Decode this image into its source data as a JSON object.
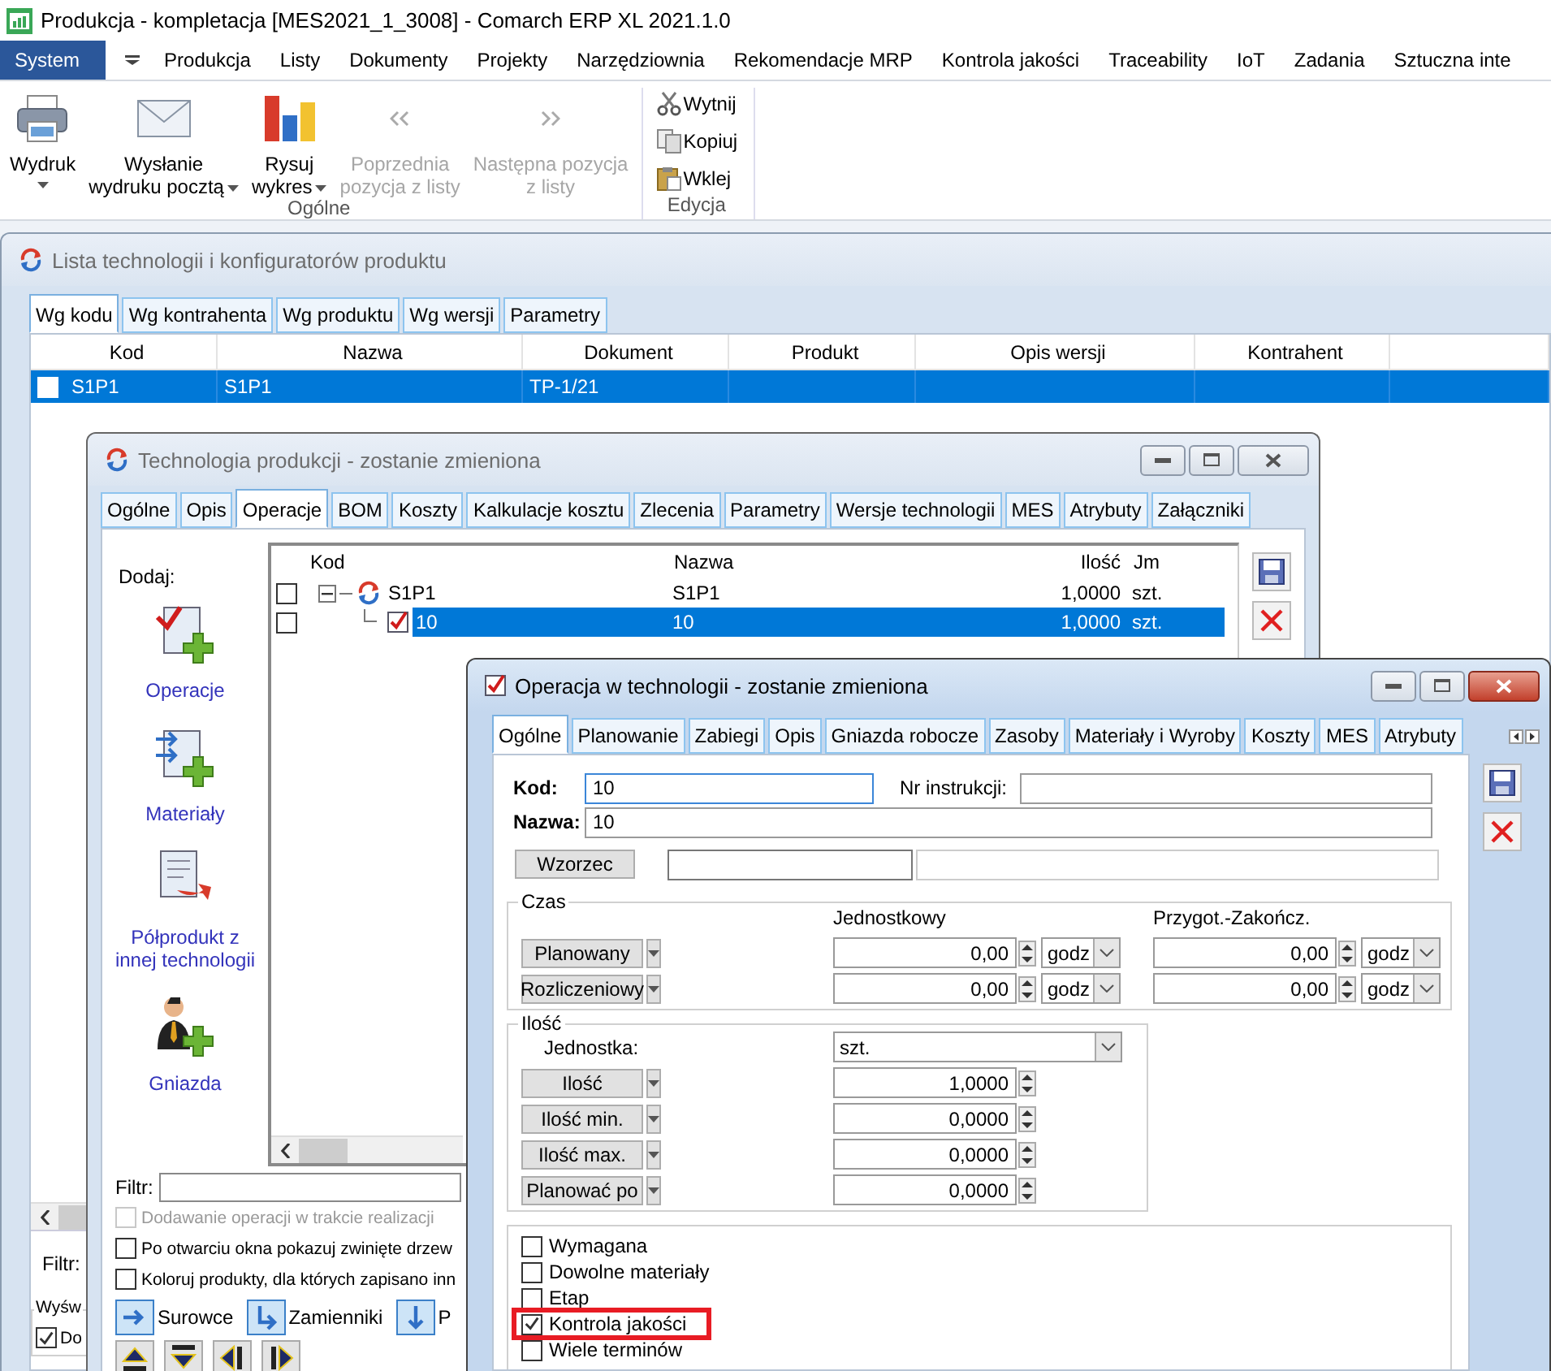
{
  "app": {
    "title": "Produkcja - kompletacja [MES2021_1_3008] - Comarch ERP XL 2021.1.0"
  },
  "ribbon": {
    "tabs": [
      {
        "label": "System",
        "selected": true
      },
      {
        "label": "Produkcja",
        "selected": false
      },
      {
        "label": "Listy",
        "selected": false
      },
      {
        "label": "Dokumenty",
        "selected": false
      },
      {
        "label": "Projekty",
        "selected": false
      },
      {
        "label": "Narzędziownia",
        "selected": false
      },
      {
        "label": "Rekomendacje MRP",
        "selected": false
      },
      {
        "label": "Kontrola jakości",
        "selected": false
      },
      {
        "label": "Traceability",
        "selected": false
      },
      {
        "label": "IoT",
        "selected": false
      },
      {
        "label": "Zadania",
        "selected": false
      },
      {
        "label": "Sztuczna inte",
        "selected": false
      }
    ],
    "groups": [
      {
        "label": "Ogólne",
        "kind": "large",
        "buttons": [
          {
            "label": "Wydruk",
            "kind": "printer",
            "dropdown": true,
            "disabled": false
          },
          {
            "label": "Wysłanie\nwydruku pocztą",
            "kind": "mail",
            "dropdown": true,
            "disabled": false
          },
          {
            "label": "Rysuj\nwykres",
            "kind": "chart",
            "dropdown": true,
            "disabled": false
          },
          {
            "label": "Poprzednia\npozycja z listy",
            "kind": "previous",
            "dropdown": false,
            "disabled": true
          },
          {
            "label": "Następna pozycja\nz listy",
            "kind": "next",
            "dropdown": false,
            "disabled": true
          }
        ]
      },
      {
        "label": "Edycja",
        "kind": "small",
        "buttons": [
          {
            "label": "Wytnij",
            "kind": "cut"
          },
          {
            "label": "Kopiuj",
            "kind": "copy"
          },
          {
            "label": "Wklej",
            "kind": "paste"
          }
        ]
      }
    ]
  },
  "list_window": {
    "title": "Lista technologii i konfiguratorów produktu",
    "tabs": [
      {
        "label": "Wg kodu",
        "selected": true
      },
      {
        "label": "Wg kontrahenta",
        "selected": false
      },
      {
        "label": "Wg produktu",
        "selected": false
      },
      {
        "label": "Wg wersji",
        "selected": false
      },
      {
        "label": "Parametry",
        "selected": false
      }
    ],
    "table": {
      "columns": [
        "Kod",
        "Nazwa",
        "Dokument",
        "Produkt",
        "Opis wersji",
        "Kontrahent"
      ],
      "rows": [
        {
          "checked": false,
          "selected": true,
          "cells": [
            "S1P1",
            "S1P1",
            "TP-1/21"
          ]
        }
      ]
    },
    "filter": {
      "label": "Filtr:"
    },
    "display_group": {
      "label": "Wyśw",
      "option": {
        "label": "Do",
        "checked": true
      }
    }
  },
  "technology_window": {
    "title": "Technologia produkcji - zostanie zmieniona",
    "tabs": [
      {
        "label": "Ogólne",
        "selected": false
      },
      {
        "label": "Opis",
        "selected": false
      },
      {
        "label": "Operacje",
        "selected": true
      },
      {
        "label": "BOM",
        "selected": false
      },
      {
        "label": "Koszty",
        "selected": false
      },
      {
        "label": "Kalkulacje kosztu",
        "selected": false
      },
      {
        "label": "Zlecenia",
        "selected": false
      },
      {
        "label": "Parametry",
        "selected": false
      },
      {
        "label": "Wersje technologii",
        "selected": false
      },
      {
        "label": "MES",
        "selected": false
      },
      {
        "label": "Atrybuty",
        "selected": false
      },
      {
        "label": "Załączniki",
        "selected": false
      }
    ],
    "add_panel": {
      "label": "Dodaj:",
      "items": [
        {
          "label": "Operacje",
          "kind": "operation"
        },
        {
          "label": "Materiały",
          "kind": "material"
        },
        {
          "label": "Półprodukt z\ninnej technologii",
          "kind": "semi"
        },
        {
          "label": "Gniazda",
          "kind": "station"
        }
      ]
    },
    "tree": {
      "columns": [
        "Kod",
        "Nazwa",
        "Ilość",
        "Jm"
      ],
      "rows": [
        {
          "code": "S1P1",
          "name": "S1P1",
          "qty": "1,0000",
          "unit": "szt.",
          "kind": "technology",
          "checked": false,
          "selected": false,
          "expanded": true,
          "children": [
            {
              "code": "10",
              "name": "10",
              "qty": "1,0000",
              "unit": "szt.",
              "kind": "operation",
              "checked": false,
              "selected": true
            }
          ]
        }
      ]
    },
    "filter": {
      "label": "Filtr:"
    },
    "options": [
      {
        "label": "Dodawanie operacji w trakcie realizacji",
        "checked": false,
        "disabled": true
      },
      {
        "label": "Po otwarciu okna pokazuj zwinięte drzew",
        "checked": false,
        "disabled": false
      },
      {
        "label": "Koloruj produkty, dla których zapisano inn",
        "checked": false,
        "disabled": false
      }
    ],
    "view_buttons": [
      {
        "label": "Surowce",
        "kind": "right"
      },
      {
        "label": "Zamienniki",
        "kind": "turn"
      },
      {
        "label": "P",
        "kind": "down"
      }
    ],
    "move_buttons": [
      {
        "kind": "up"
      },
      {
        "kind": "down"
      },
      {
        "kind": "left"
      },
      {
        "kind": "right"
      }
    ]
  },
  "operation_window": {
    "title": "Operacja w technologii - zostanie zmieniona",
    "tabs": [
      {
        "label": "Ogólne",
        "selected": true
      },
      {
        "label": "Planowanie",
        "selected": false
      },
      {
        "label": "Zabiegi",
        "selected": false
      },
      {
        "label": "Opis",
        "selected": false
      },
      {
        "label": "Gniazda robocze",
        "selected": false
      },
      {
        "label": "Zasoby",
        "selected": false
      },
      {
        "label": "Materiały i Wyroby",
        "selected": false
      },
      {
        "label": "Koszty",
        "selected": false
      },
      {
        "label": "MES",
        "selected": false
      },
      {
        "label": "Atrybuty",
        "selected": false
      }
    ],
    "code": {
      "label": "Kod:",
      "value": "10"
    },
    "instruction": {
      "label": "Nr instrukcji:"
    },
    "name": {
      "label": "Nazwa:",
      "value": "10"
    },
    "template": {
      "label": "Wzorzec"
    },
    "time": {
      "label": "Czas",
      "columns": [
        "Jednostkowy",
        "Przygot.-Zakończ."
      ],
      "rows": [
        {
          "label": "Planowany",
          "values": [
            {
              "value": "0,00",
              "unit": "godz"
            },
            {
              "value": "0,00",
              "unit": "godz"
            }
          ]
        },
        {
          "label": "Rozliczeniowy",
          "values": [
            {
              "value": "0,00",
              "unit": "godz"
            },
            {
              "value": "0,00",
              "unit": "godz"
            }
          ]
        }
      ]
    },
    "quantity": {
      "label": "Ilość",
      "unit": {
        "label": "Jednostka:",
        "value": "szt."
      },
      "rows": [
        {
          "label": "Ilość",
          "value": "1,0000"
        },
        {
          "label": "Ilość min.",
          "value": "0,0000"
        },
        {
          "label": "Ilość max.",
          "value": "0,0000"
        },
        {
          "label": "Planować po",
          "value": "0,0000"
        }
      ]
    },
    "flags": [
      {
        "label": "Wymagana",
        "checked": false,
        "highlighted": false
      },
      {
        "label": "Dowolne materiały",
        "checked": false,
        "highlighted": false
      },
      {
        "label": "Etap",
        "checked": false,
        "highlighted": false
      },
      {
        "label": "Kontrola jakości",
        "checked": true,
        "highlighted": true
      },
      {
        "label": "Wiele terminów",
        "checked": false,
        "highlighted": false
      }
    ]
  }
}
